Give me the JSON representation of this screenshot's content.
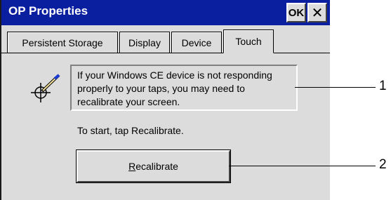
{
  "window": {
    "title": "OP Properties",
    "ok_label": "OK",
    "close_glyph": "✕"
  },
  "tabs": [
    {
      "label": "Persistent Storage",
      "active": false
    },
    {
      "label": "Display",
      "active": false
    },
    {
      "label": "Device",
      "active": false
    },
    {
      "label": "Touch",
      "active": true
    }
  ],
  "touch": {
    "icon": "stylus-crosshair-icon",
    "info_text": "If your Windows CE device is not responding properly to your taps, you may need to recalibrate your screen.",
    "start_text": "To start, tap Recalibrate.",
    "recalibrate_prefix": "R",
    "recalibrate_rest": "ecalibrate"
  },
  "callouts": [
    {
      "number": "1"
    },
    {
      "number": "2"
    }
  ],
  "colors": {
    "titlebar": "#0a1ea0",
    "window_bg": "#dcdcdc"
  }
}
